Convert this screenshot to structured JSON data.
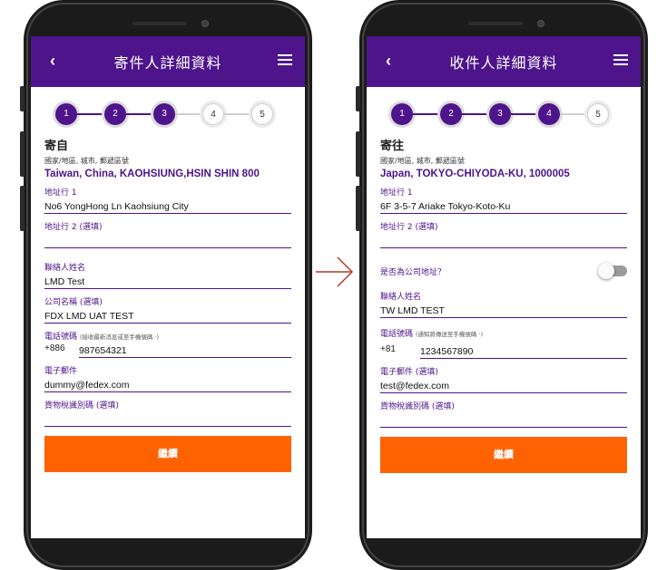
{
  "sender": {
    "header": {
      "back_icon": "‹",
      "title": "寄件人詳細資料"
    },
    "stepper": {
      "steps": [
        "1",
        "2",
        "3",
        "4",
        "5"
      ],
      "completed": 3
    },
    "section_title": "寄自",
    "section_sub": "國家/地區, 城市, 郵遞區號",
    "location": "Taiwan, China,  KAOHSIUNG,HSIN SHIN 800",
    "address1_label": "地址行 1",
    "address1_value": "No6 YongHong Ln Kaohsiung City",
    "address2_label": "地址行 2 (選填)",
    "address2_value": "",
    "contact_label": "聯絡人姓名",
    "contact_value": "LMD Test",
    "company_label": "公司名稱 (選填)",
    "company_value": "FDX LMD UAT TEST",
    "phone_label": "電話號碼",
    "phone_hint": "(接收最新消息或至手機號碼 ·)",
    "phone_cc": "+886",
    "phone_value": "987654321",
    "email_label": "電子郵件",
    "email_value": "dummy@fedex.com",
    "tax_label": "貨物稅識別碼 (選填)",
    "tax_value": "",
    "continue_label": "繼續"
  },
  "recipient": {
    "header": {
      "back_icon": "‹",
      "title": "收件人詳細資料"
    },
    "stepper": {
      "steps": [
        "1",
        "2",
        "3",
        "4",
        "5"
      ],
      "completed": 4
    },
    "section_title": "寄往",
    "section_sub": "國家/地區, 城市, 郵遞區號",
    "location": "Japan, TOKYO-CHIYODA-KU, 1000005",
    "address1_label": "地址行 1",
    "address1_value": "6F 3-5-7 Ariake Tokyo-Koto-Ku",
    "address2_label": "地址行 2 (選填)",
    "address2_value": "",
    "company_toggle_label": "是否為公司地址？",
    "company_toggle_on": false,
    "contact_label": "聯絡人姓名",
    "contact_value": "TW LMD TEST",
    "phone_label": "電話號碼",
    "phone_hint": "(通知將傳送至手機號碼 ·)",
    "phone_cc": "+81",
    "phone_value": "1234567890",
    "email_label": "電子郵件 (選填)",
    "email_value": "test@fedex.com",
    "tax_label": "貨物稅識別碼 (選填)",
    "tax_value": "",
    "continue_label": "繼續"
  },
  "colors": {
    "brand_purple": "#4d148c",
    "accent_orange": "#ff6200",
    "arrow": "#b0392e"
  },
  "icons": {
    "back": "chevron-left-icon",
    "menu": "hamburger-menu-icon",
    "arrow": "arrow-right-icon"
  }
}
